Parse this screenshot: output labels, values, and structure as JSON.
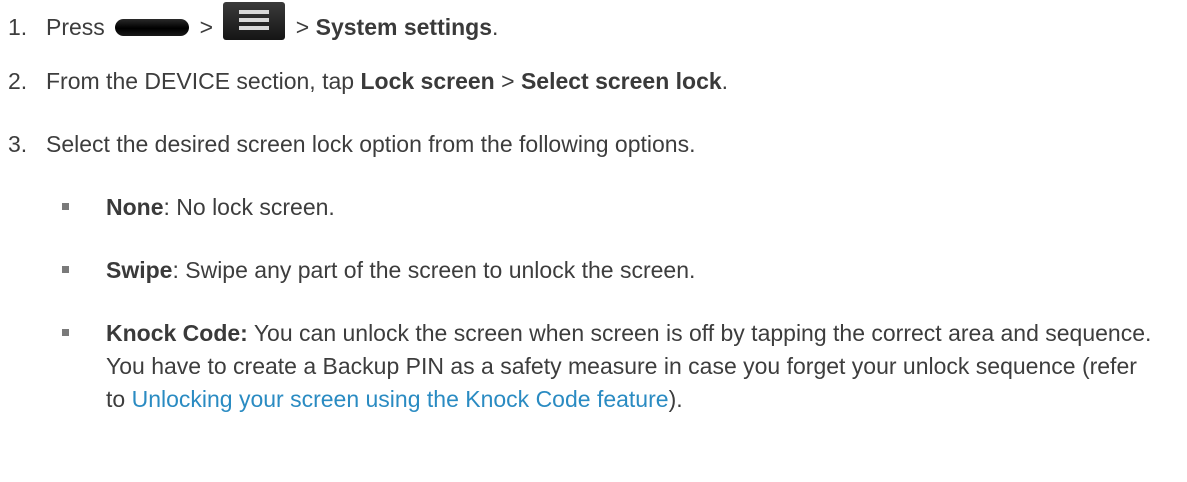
{
  "steps": [
    {
      "num": "1.",
      "press": "Press",
      "home_key_icon": "home-key-icon",
      "sep1": ">",
      "menu_key_icon": "menu-key-icon",
      "sep2": ">",
      "target": "System settings",
      "end": "."
    },
    {
      "num": "2.",
      "pre": "From the DEVICE section, tap",
      "b1": "Lock screen",
      "sep": ">",
      "b2": "Select screen lock",
      "end": "."
    },
    {
      "num": "3.",
      "text": "Select the desired screen lock option from the following options."
    }
  ],
  "options": [
    {
      "name": "None",
      "desc": ": No lock screen."
    },
    {
      "name": "Swipe",
      "desc": ": Swipe any part of the screen to unlock the screen."
    },
    {
      "name": "Knock Code:",
      "desc": " You can unlock the screen when screen is off by tapping the correct area and sequence. You have to create a Backup PIN as a safety measure in case you forget your unlock sequence (refer to ",
      "link": "Unlocking your screen using the Knock Code feature",
      "end": ")."
    }
  ],
  "colors": {
    "text": "#3d3d3d",
    "link": "#2a8bc2"
  }
}
